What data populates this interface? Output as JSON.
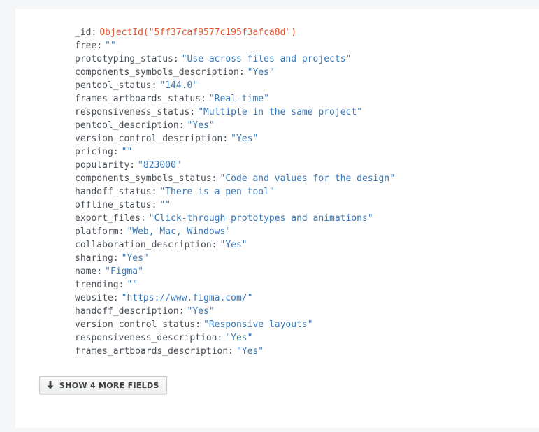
{
  "document": {
    "fields": [
      {
        "key": "_id",
        "value": "ObjectId(\"5ff37caf9577c195f3afca8d\")",
        "type": "objectid"
      },
      {
        "key": "free",
        "value": "\"\"",
        "type": "string"
      },
      {
        "key": "prototyping_status",
        "value": "\"Use across files and projects\"",
        "type": "string"
      },
      {
        "key": "components_symbols_description",
        "value": "\"Yes\"",
        "type": "string"
      },
      {
        "key": "pentool_status",
        "value": "\"144.0\"",
        "type": "string"
      },
      {
        "key": "frames_artboards_status",
        "value": "\"Real-time\"",
        "type": "string"
      },
      {
        "key": "responsiveness_status",
        "value": "\"Multiple in the same project\"",
        "type": "string"
      },
      {
        "key": "pentool_description",
        "value": "\"Yes\"",
        "type": "string"
      },
      {
        "key": "version_control_description",
        "value": "\"Yes\"",
        "type": "string"
      },
      {
        "key": "pricing",
        "value": "\"\"",
        "type": "string"
      },
      {
        "key": "popularity",
        "value": "\"823000\"",
        "type": "string"
      },
      {
        "key": "components_symbols_status",
        "value": "\"Code and values for the design\"",
        "type": "string"
      },
      {
        "key": "handoff_status",
        "value": "\"There is a pen tool\"",
        "type": "string"
      },
      {
        "key": "offline_status",
        "value": "\"\"",
        "type": "string"
      },
      {
        "key": "export_files",
        "value": "\"Click-through prototypes and animations\"",
        "type": "string"
      },
      {
        "key": "platform",
        "value": "\"Web, Mac, Windows\"",
        "type": "string"
      },
      {
        "key": "collaboration_description",
        "value": "\"Yes\"",
        "type": "string"
      },
      {
        "key": "sharing",
        "value": "\"Yes\"",
        "type": "string"
      },
      {
        "key": "name",
        "value": "\"Figma\"",
        "type": "string"
      },
      {
        "key": "trending",
        "value": "\"\"",
        "type": "string"
      },
      {
        "key": "website",
        "value": "\"https://www.figma.com/\"",
        "type": "string"
      },
      {
        "key": "handoff_description",
        "value": "\"Yes\"",
        "type": "string"
      },
      {
        "key": "version_control_status",
        "value": "\"Responsive layouts\"",
        "type": "string"
      },
      {
        "key": "responsiveness_description",
        "value": "\"Yes\"",
        "type": "string"
      },
      {
        "key": "frames_artboards_description",
        "value": "\"Yes\"",
        "type": "string"
      }
    ],
    "separator": ":",
    "show_more_label": "SHOW 4 MORE FIELDS",
    "show_more_icon": "arrow-down-icon"
  },
  "colors": {
    "key": "#495057",
    "string_value": "#3a78b5",
    "objectid_value": "#e8542c",
    "background": "#f5f6f7",
    "card": "#ffffff"
  }
}
